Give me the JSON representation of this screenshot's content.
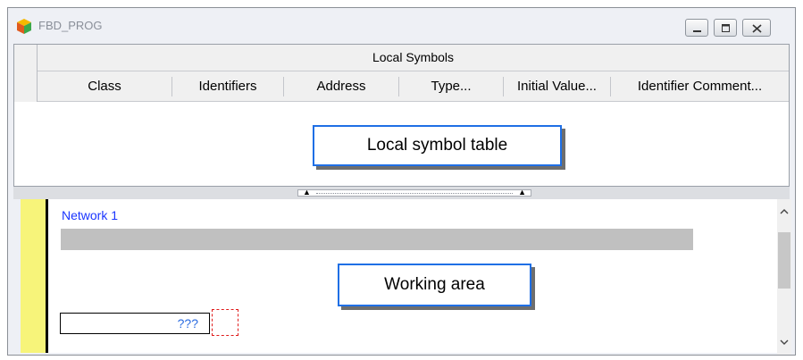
{
  "window": {
    "title": "FBD_PROG",
    "app_icon": "cube-icon",
    "controls": [
      "minimize-icon",
      "maximize-icon",
      "close-icon"
    ]
  },
  "local_symbols": {
    "banner": "Local Symbols",
    "columns": [
      "Class",
      "Identifiers",
      "Address",
      "Type...",
      "Initial Value...",
      "Identifier Comment..."
    ],
    "callout": "Local symbol table"
  },
  "working_area": {
    "network_label": "Network 1",
    "input_value": "???",
    "callout": "Working area"
  },
  "colors": {
    "callout_border": "#1f6fe5",
    "network_label": "#1a35ff",
    "rail_yellow": "#f7f47a",
    "block_outline": "#e01a1a"
  }
}
